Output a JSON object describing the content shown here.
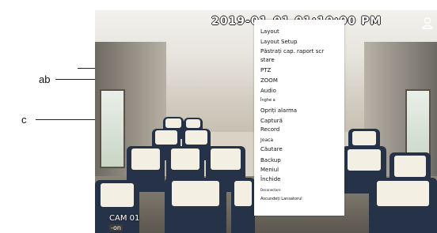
{
  "callouts": {
    "ab": "ab",
    "c": "c"
  },
  "screen": {
    "timestamp": "2019-01-01 01:10:00 PM",
    "camera_label": "CAM 01",
    "camera_sub": "-on",
    "user_icon": "user-icon"
  },
  "context_menu": {
    "items": [
      "Layout",
      "Layout Setup",
      "Păstrați cap. raport scr",
      "stare",
      "PTZ",
      "ZOOM",
      "Audio",
      "Înghe a",
      "Opriți alarma",
      "Captură",
      "Record",
      "Joaca",
      "Căutare",
      "Backup",
      "Meniul",
      "Închide",
      "Deconectare",
      "Ascundeți Lansatorul"
    ]
  },
  "colors": {
    "menu_background": "#ffffff",
    "overlay_text": "#ffffff"
  }
}
